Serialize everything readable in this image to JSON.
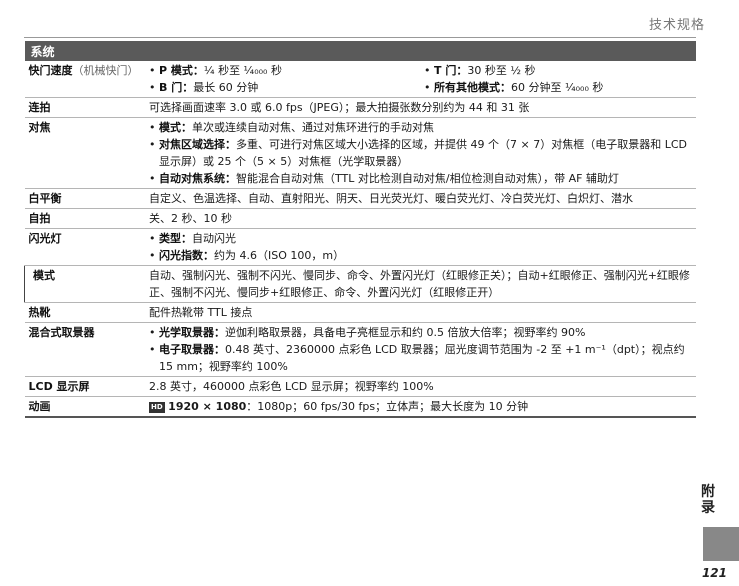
{
  "header": {
    "title": "技术规格"
  },
  "section": "系统",
  "rows": {
    "shutter": {
      "label": "快门速度",
      "label_sub": "（机械快门）",
      "p_label": "P 模式：",
      "p_value": "¼ 秒至 ¹⁄₄₀₀₀ 秒",
      "b_label": "B 门：",
      "b_value": "最长 60 分钟",
      "t_label": "T 门：",
      "t_value": "30 秒至 ½ 秒",
      "other_label": "所有其他模式：",
      "other_value": "60 分钟至 ¹⁄₄₀₀₀ 秒"
    },
    "burst": {
      "label": "连拍",
      "value": "可选择画面速率 3.0 或 6.0 fps（JPEG）；最大拍摄张数分别约为 44 和 31 张"
    },
    "focus": {
      "label": "对焦",
      "mode_label": "模式：",
      "mode_value": "单次或连续自动对焦、通过对焦环进行的手动对焦",
      "area_label": "对焦区域选择：",
      "area_value": "多重、可进行对焦区域大小选择的区域，并提供 49 个（7 × 7）对焦框（电子取景器和 LCD 显示屏）或 25 个（5 × 5）对焦框（光学取景器）",
      "af_label": "自动对焦系统：",
      "af_value": "智能混合自动对焦（TTL 对比检测自动对焦/相位检测自动对焦），带 AF 辅助灯"
    },
    "wb": {
      "label": "白平衡",
      "value": "自定义、色温选择、自动、直射阳光、阴天、日光荧光灯、暖白荧光灯、冷白荧光灯、白炽灯、潜水"
    },
    "selftimer": {
      "label": "自拍",
      "value": "关、2 秒、10 秒"
    },
    "flash": {
      "label": "闪光灯",
      "type_label": "类型：",
      "type_value": "自动闪光",
      "gn_label": "闪光指数：",
      "gn_value": "约为 4.6（ISO 100，m）"
    },
    "flashmode": {
      "label": "模式",
      "value": "自动、强制闪光、强制不闪光、慢同步、命令、外置闪光灯（红眼修正关）；自动+红眼修正、强制闪光+红眼修正、强制不闪光、慢同步+红眼修正、命令、外置闪光灯（红眼修正开）"
    },
    "hotshoe": {
      "label": "热靴",
      "value": "配件热靴带 TTL 接点"
    },
    "finder": {
      "label": "混合式取景器",
      "ovf_label": "光学取景器：",
      "ovf_value": "逆伽利略取景器，具备电子亮框显示和约 0.5 倍放大倍率；视野率约 90%",
      "evf_label": "电子取景器：",
      "evf_value": "0.48 英寸、2360000 点彩色 LCD 取景器；屈光度调节范围为 -2 至 +1 m⁻¹（dpt）；视点约 15 mm；视野率约 100%"
    },
    "lcd": {
      "label": "LCD 显示屏",
      "value": "2.8 英寸，460000 点彩色 LCD 显示屏；视野率约 100%"
    },
    "movie": {
      "label": "动画",
      "badge": "HD",
      "res": "1920 × 1080",
      "value": "：1080p；60 fps/30 fps；立体声；最大长度为 10 分钟"
    }
  },
  "side_tab": "附录",
  "page_number": "121"
}
